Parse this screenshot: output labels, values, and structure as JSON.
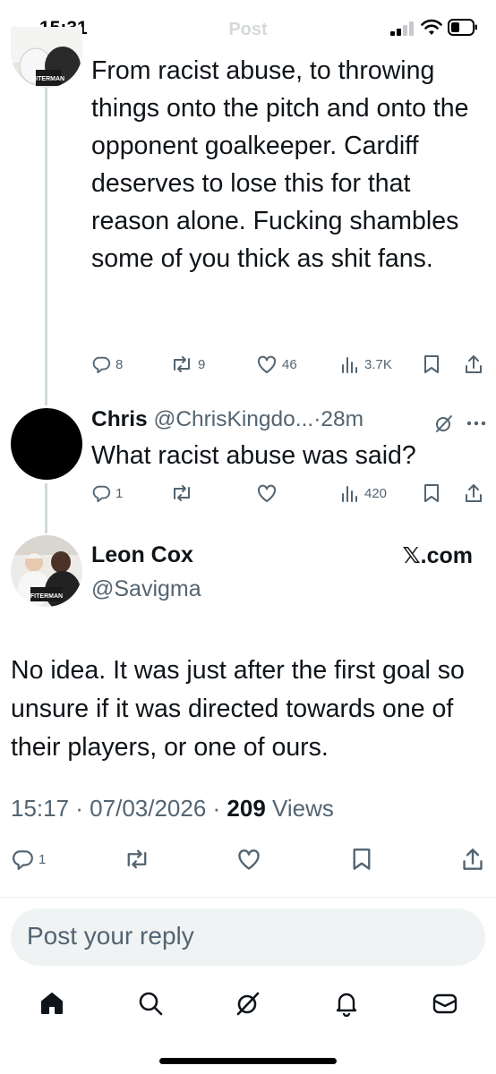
{
  "status_bar": {
    "time": "15:31",
    "ghost_title": "Post"
  },
  "parent_tweet": {
    "text": "From racist abuse, to throwing things onto the pitch and onto the opponent goalkeeper. Cardiff deserves to lose this for that reason alone. Fucking shambles some of you thick as shit fans.",
    "replies": "8",
    "reposts": "9",
    "likes": "46",
    "views": "3.7K"
  },
  "reply_tweet": {
    "name": "Chris",
    "handle_time": "@ChrisKingdo...·28m",
    "text": "What racist abuse was said?",
    "replies": "1",
    "views": "420"
  },
  "main_tweet": {
    "name": "Leon Cox",
    "handle": "@Savigma",
    "watermark": "𝕏.com",
    "text": "No idea. It was just after the first goal so unsure if it was directed towards one of their players, or one of ours.",
    "time_date": "15:17 · 07/03/2026 · ",
    "views_count": "209",
    "views_label": " Views",
    "replies": "1"
  },
  "reply_box": {
    "placeholder": "Post your reply"
  },
  "icons": {
    "reply": "reply-icon",
    "repost": "repost-icon",
    "like": "heart-icon",
    "views": "views-icon",
    "bookmark": "bookmark-icon",
    "share": "share-icon",
    "grok": "grok-icon",
    "more": "more-icon",
    "home": "home-icon",
    "search": "search-icon",
    "notifications": "bell-icon",
    "messages": "mail-icon"
  },
  "colors": {
    "text": "#0f1419",
    "muted": "#536471",
    "thread_line": "#cfd9de",
    "reply_box_bg": "#eff3f4"
  }
}
